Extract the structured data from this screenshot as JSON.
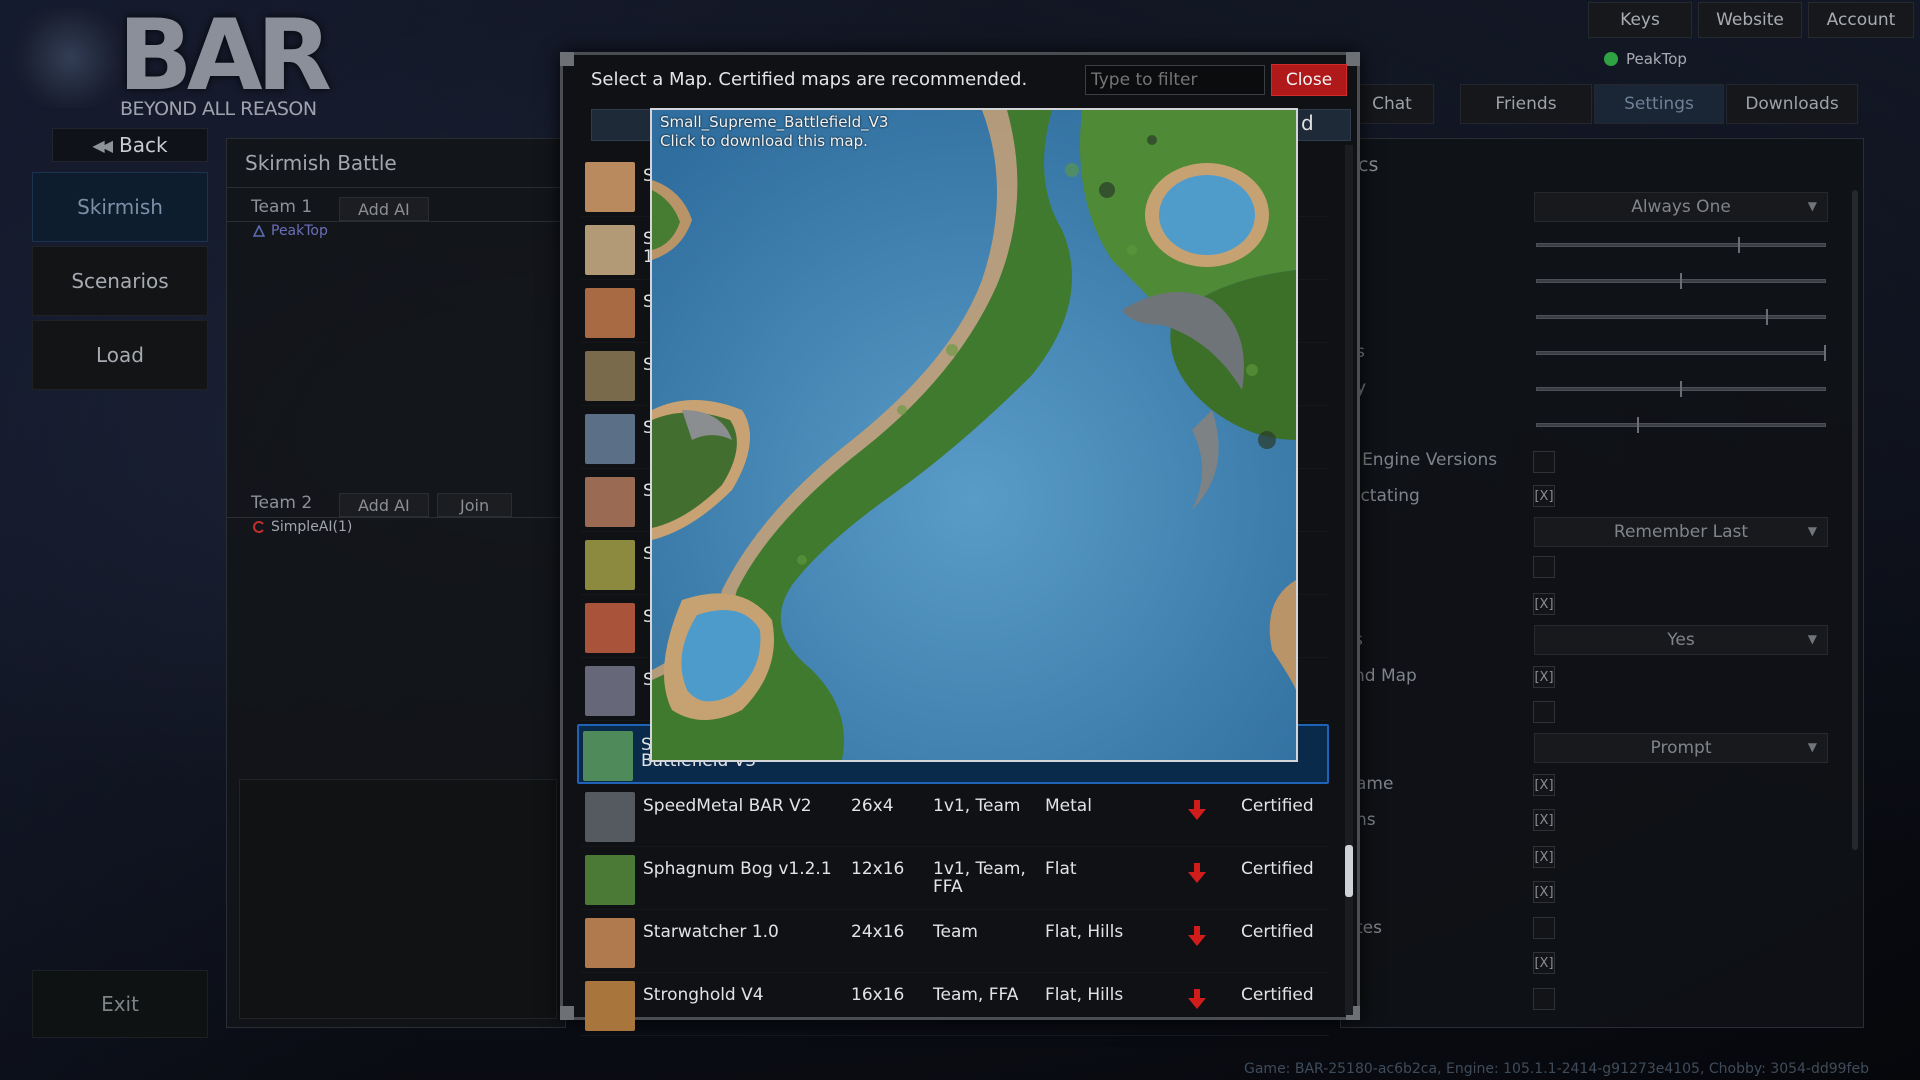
{
  "logo": {
    "title": "BAR",
    "subtitle": "BEYOND ALL REASON"
  },
  "nav": {
    "back_label": "Back",
    "items": [
      {
        "label": "Skirmish"
      },
      {
        "label": "Scenarios"
      },
      {
        "label": "Load"
      }
    ],
    "exit_label": "Exit"
  },
  "top_buttons": [
    "Keys",
    "Website",
    "Account"
  ],
  "user": {
    "name": "PeakTop",
    "status_color": "#2fa344"
  },
  "tabs": [
    "Chat",
    "Friends",
    "Settings",
    "Downloads"
  ],
  "skirmish": {
    "title": "Skirmish Battle",
    "team1": {
      "label": "Team 1",
      "add_ai": "Add AI",
      "player": "PeakTop"
    },
    "team2": {
      "label": "Team 2",
      "add_ai": "Add AI",
      "join": "Join",
      "player": "SimpleAI(1)"
    }
  },
  "settings": {
    "header_fragment": "cs",
    "labels": [
      "s",
      "y",
      "t Engine Versions",
      "ectating",
      "s",
      "nd Map",
      "ame",
      "ns",
      "tes"
    ],
    "dropdowns": [
      "Always One",
      "Remember Last",
      "Yes",
      "Prompt"
    ],
    "slider_levels": [
      0.7,
      0.5,
      0.8,
      1.0,
      0.5,
      0.35
    ],
    "checkbox_marks": [
      "",
      "[X]",
      "",
      "[X]",
      "[X]",
      "",
      "[X]",
      "[X]",
      "[X]",
      "[X]",
      "",
      "[X]",
      ""
    ]
  },
  "version_text": "Game: BAR-25180-ac6b2ca, Engine: 105.1.1-2414-g91273e4105, Chobby: 3054-dd99feb",
  "modal": {
    "header": "Select a Map. Certified maps are recommended.",
    "filter_placeholder": "Type to filter",
    "close_label": "Close",
    "list_header_fragment": "d",
    "partial_rows": [
      {
        "name": "S",
        "thumb": "#b98a5e"
      },
      {
        "name": "S\n1.",
        "thumb": "#b39a76"
      },
      {
        "name": "S",
        "thumb": "#a86a42"
      },
      {
        "name": "S",
        "thumb": "#7a6a4c"
      },
      {
        "name": "S",
        "thumb": "#5b6f86"
      },
      {
        "name": "S",
        "thumb": "#9a6a52"
      },
      {
        "name": "S",
        "thumb": "#8c8a3e"
      },
      {
        "name": "S",
        "thumb": "#a9543a"
      },
      {
        "name": "S",
        "thumb": "#66687a"
      }
    ],
    "selected_row": {
      "name": "S",
      "name_line2": "Battlefield V3",
      "thumb": "#4f8a5a"
    },
    "rows": [
      {
        "name": "SpeedMetal BAR V2",
        "size": "26x4",
        "type": "1v1, Team",
        "terrain": "Metal",
        "status": "Certified",
        "thumb": "#555a60"
      },
      {
        "name": "Sphagnum Bog v1.2.1",
        "size": "12x16",
        "type": "1v1, Team,\nFFA",
        "terrain": "Flat",
        "status": "Certified",
        "thumb": "#4b7a36"
      },
      {
        "name": "Starwatcher 1.0",
        "size": "24x16",
        "type": "Team",
        "terrain": "Flat, Hills",
        "status": "Certified",
        "thumb": "#b07a4e"
      },
      {
        "name": "Stronghold V4",
        "size": "16x16",
        "type": "Team, FFA",
        "terrain": "Flat, Hills",
        "status": "Certified",
        "thumb": "#a8763c"
      }
    ],
    "download_icon_color": "#d11c1c"
  },
  "preview": {
    "title": "Small_Supreme_Battlefield_V3",
    "subtitle": "Click to download this map."
  }
}
